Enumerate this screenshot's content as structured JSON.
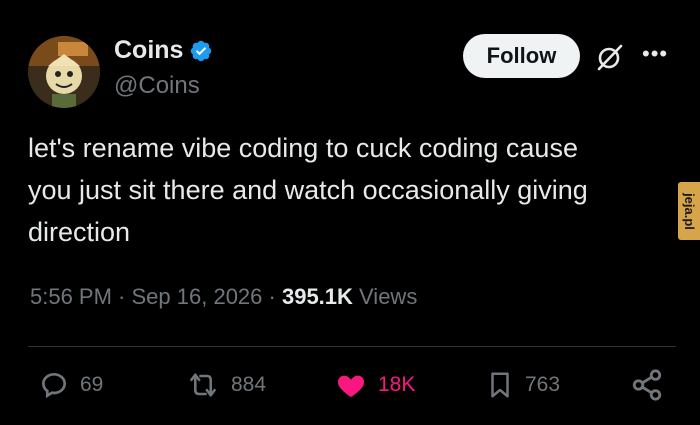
{
  "author": {
    "name": "Coins",
    "handle": "@Coins"
  },
  "follow_label": "Follow",
  "tweet_text": "let's rename vibe coding to cuck coding cause\nyou just sit there and watch occasionally giving\ndirection",
  "meta": {
    "time": "5:56 PM",
    "sep1": " · ",
    "date": "Sep 16, 2026",
    "sep2": " · ",
    "views_count": "395.1K",
    "views_label": " Views"
  },
  "actions": {
    "replies": "69",
    "reposts": "884",
    "likes": "18K",
    "bookmarks": "763"
  },
  "watermark": "jeja.pl",
  "colors": {
    "background": "#000000",
    "text": "#e7e9ea",
    "secondary": "#71767b",
    "like_active": "#f91880",
    "verified": "#1d9bf0"
  },
  "icons": [
    "verified-badge-icon",
    "grok-icon",
    "more-icon",
    "reply-icon",
    "repost-icon",
    "like-icon",
    "bookmark-icon",
    "share-icon"
  ]
}
